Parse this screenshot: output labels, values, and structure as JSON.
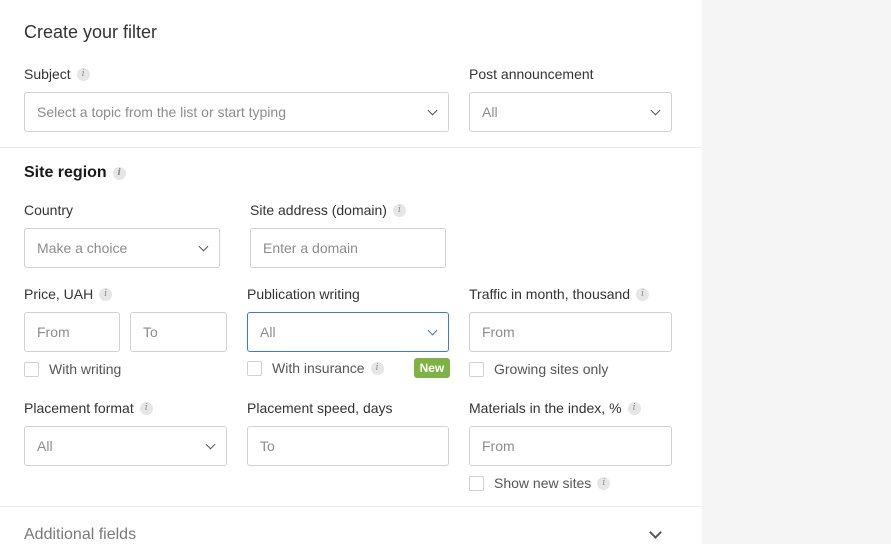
{
  "filter": {
    "title": "Create your filter",
    "subject": {
      "label": "Subject",
      "placeholder": "Select a topic from the list or start typing"
    },
    "post_announcement": {
      "label": "Post announcement",
      "value": "All"
    }
  },
  "site_region": {
    "heading": "Site region",
    "country": {
      "label": "Country",
      "placeholder": "Make a choice"
    },
    "domain": {
      "label": "Site address (domain)",
      "placeholder": "Enter a domain"
    },
    "price": {
      "label": "Price, UAH",
      "from": "From",
      "to": "To",
      "checkbox": "With writing"
    },
    "publication": {
      "label": "Publication writing",
      "value": "All",
      "checkbox": "With insurance",
      "badge": "New"
    },
    "traffic": {
      "label": "Traffic in month, thousand",
      "from": "From",
      "checkbox": "Growing sites only"
    },
    "placement_format": {
      "label": "Placement format",
      "value": "All"
    },
    "placement_speed": {
      "label": "Placement speed, days",
      "to": "To"
    },
    "materials": {
      "label": "Materials in the index, %",
      "from": "From",
      "checkbox": "Show new sites"
    }
  },
  "additional": {
    "label": "Additional fields"
  },
  "icons": {
    "info": "i"
  }
}
